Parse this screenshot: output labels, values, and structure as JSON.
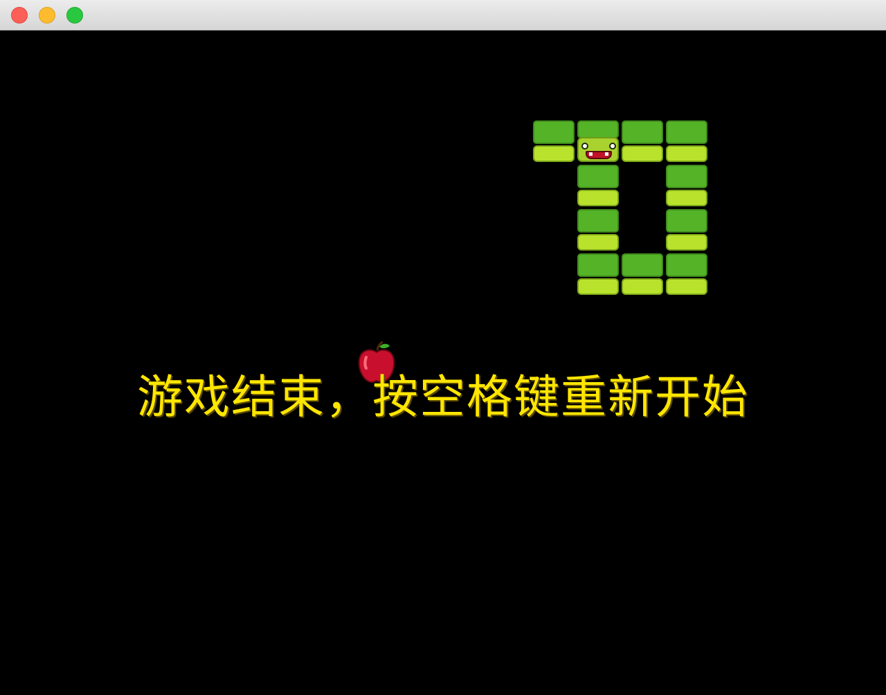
{
  "window": {
    "controls": [
      "close",
      "minimize",
      "maximize"
    ]
  },
  "game": {
    "message": "游戏结束，按空格键重新开始",
    "message_color": "#ffe600",
    "background_color": "#000000",
    "snake": {
      "body_color": "#54b327",
      "belly_color": "#b9e22d",
      "head_icon": "snake-head-icon",
      "segment_count": 12
    },
    "food": {
      "icon": "apple-icon",
      "color": "#c8102e"
    }
  }
}
